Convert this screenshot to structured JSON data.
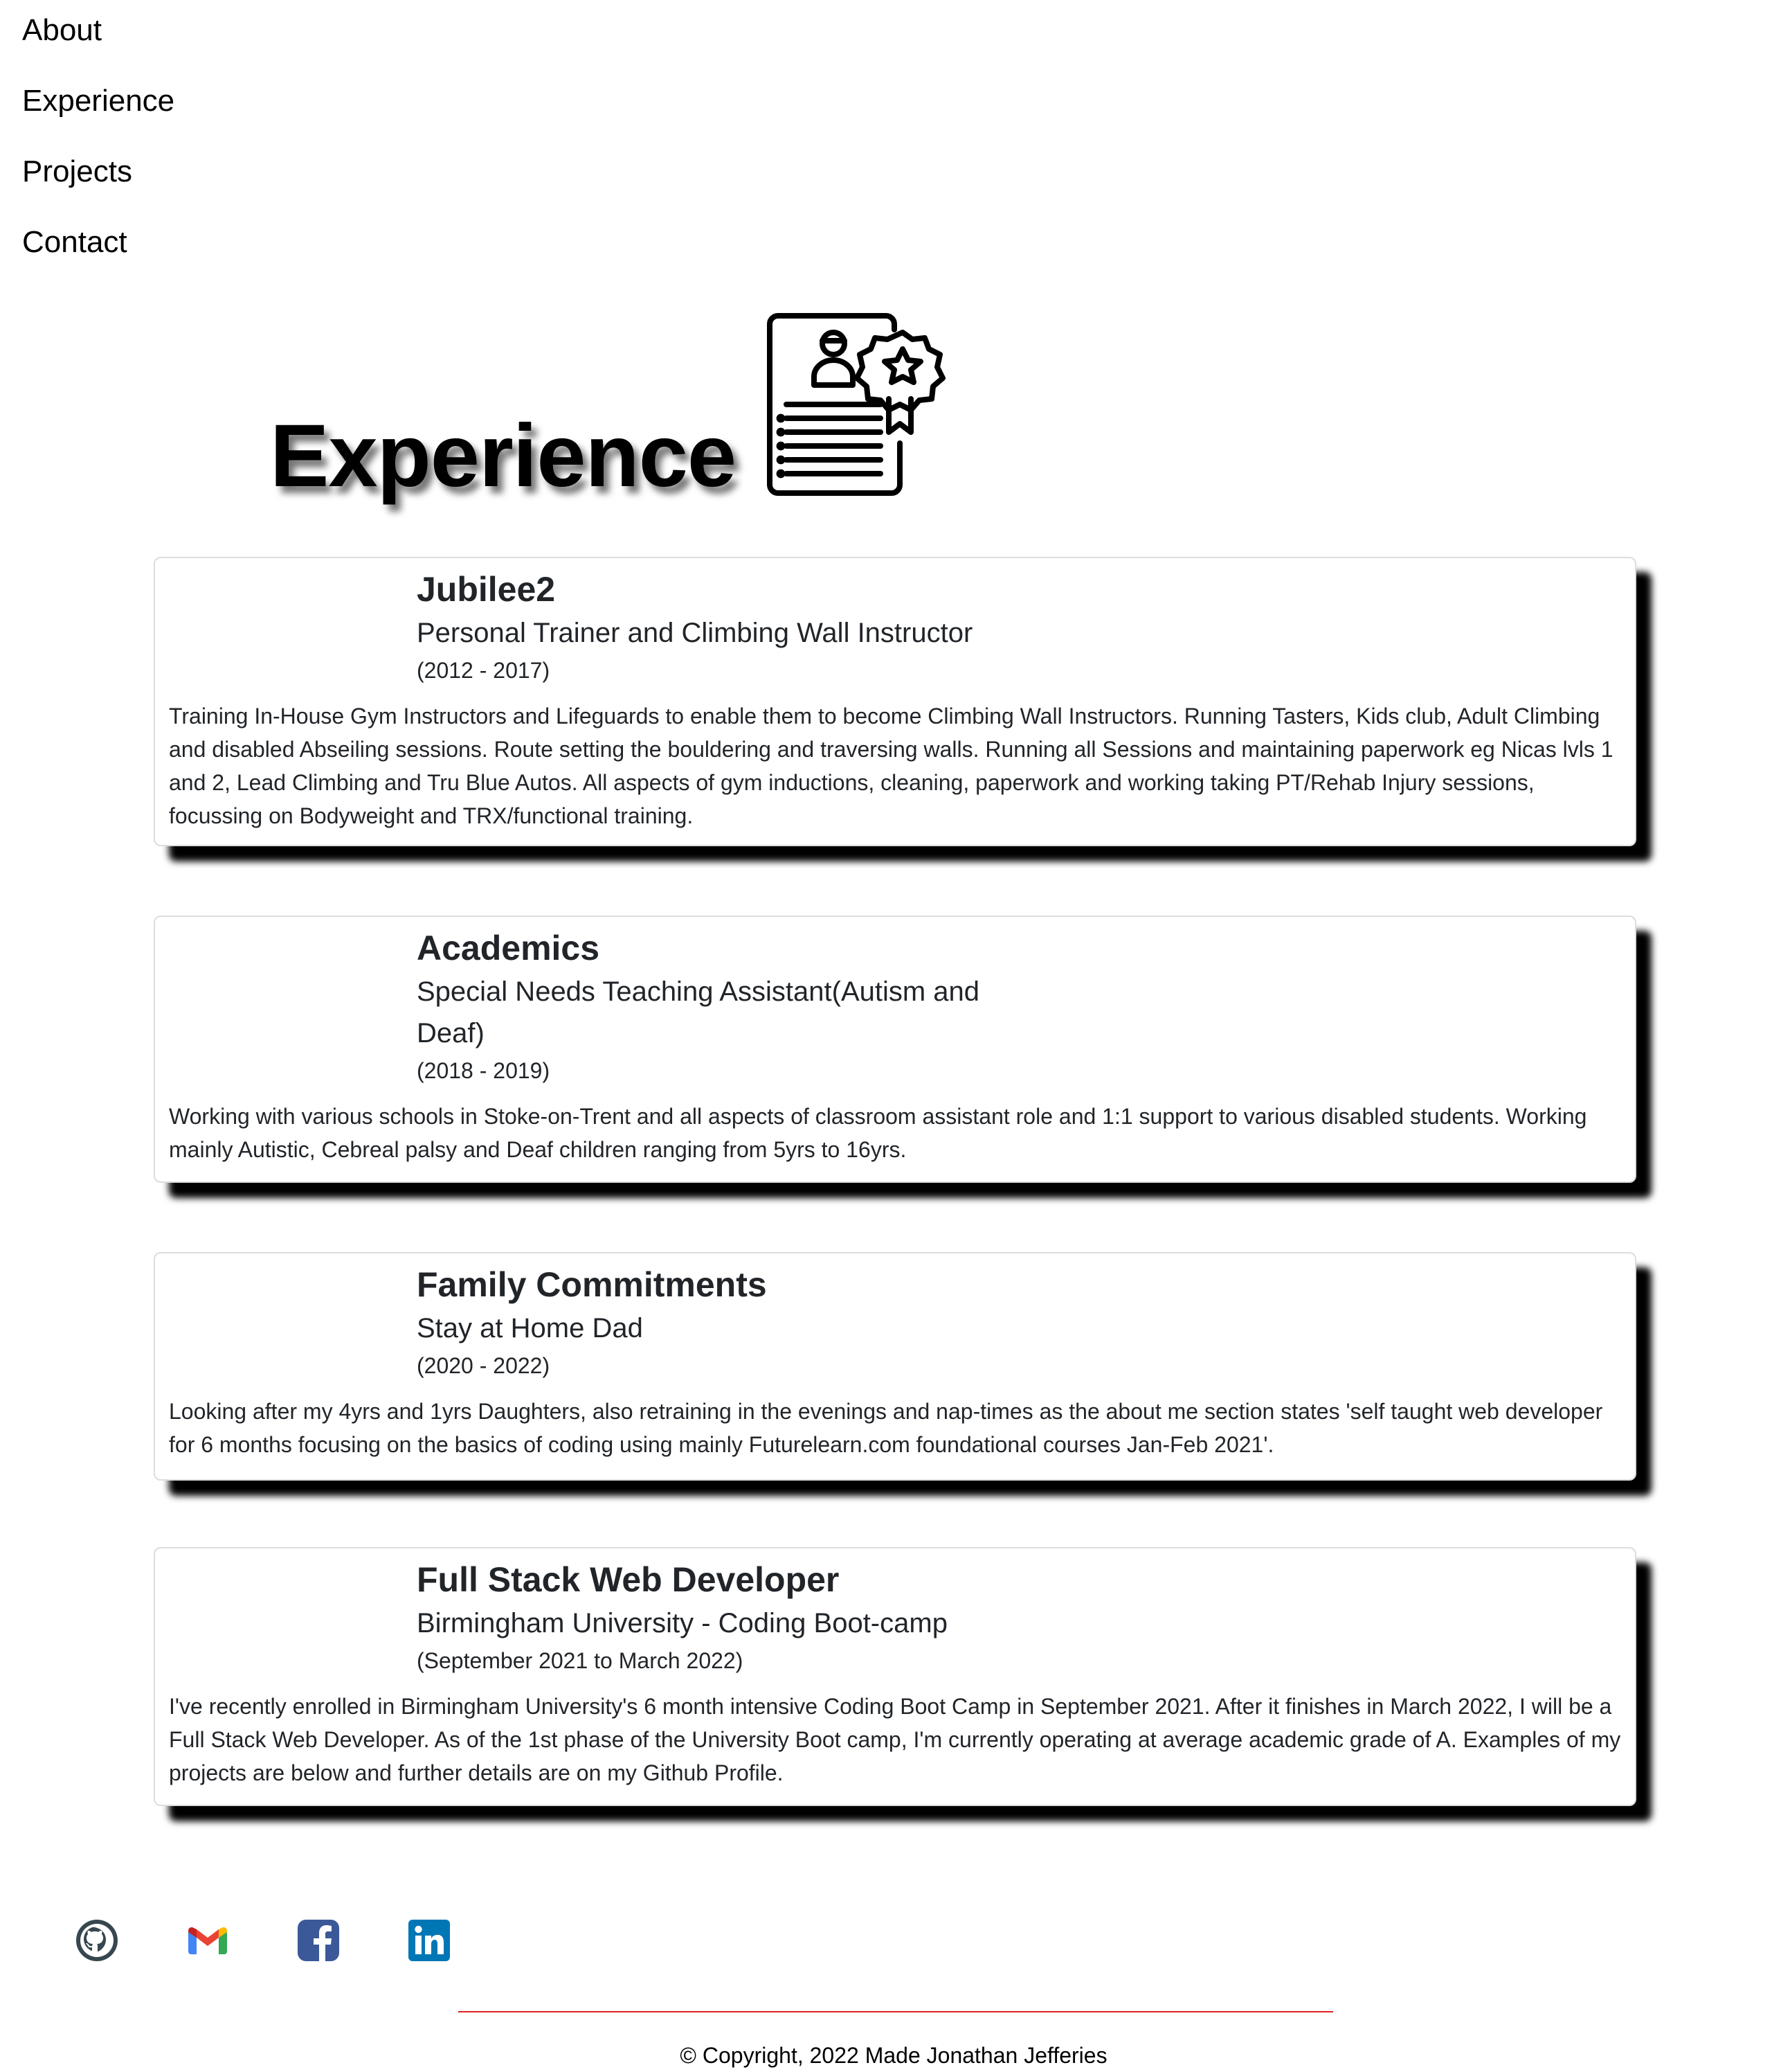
{
  "nav": {
    "items": [
      "About",
      "Experience",
      "Projects",
      "Contact"
    ]
  },
  "experience_section": {
    "title": "Experience",
    "icon": "certificate-award-icon"
  },
  "jobs": [
    {
      "company": "Jubilee2",
      "role": "Personal Trainer and Climbing Wall Instructor",
      "dates": "(2012 - 2017)",
      "description": "Training In-House Gym Instructors and Lifeguards to enable them to become Climbing Wall Instructors. Running Tasters, Kids club, Adult Climbing and disabled Abseiling sessions. Route setting the bouldering and traversing walls. Running all Sessions and maintaining paperwork eg Nicas lvls 1 and 2, Lead Climbing and Tru Blue Autos. All aspects of gym inductions, cleaning, paperwork and working taking PT/Rehab Injury sessions, focussing on Bodyweight and TRX/functional training."
    },
    {
      "company": "Academics",
      "role": "Special Needs Teaching Assistant(Autism and Deaf)",
      "dates": "(2018 - 2019)",
      "description": "Working with various schools in Stoke-on-Trent and all aspects of classroom assistant role and 1:1 support to various disabled students. Working mainly Autistic, Cebreal palsy and Deaf children ranging from 5yrs to 16yrs."
    },
    {
      "company": "Family Commitments",
      "role": "Stay at Home Dad",
      "dates": "(2020 - 2022)",
      "description": "Looking after my 4yrs and 1yrs Daughters, also retraining in the evenings and nap-times as the about me section states 'self taught web developer for 6 months focusing on the basics of coding using mainly Futurelearn.com foundational courses Jan-Feb 2021'."
    },
    {
      "company": "Full Stack Web Developer",
      "role": "Birmingham University - Coding Boot-camp",
      "dates": "(September 2021 to March 2022)",
      "description": "I've recently enrolled in Birmingham University's 6 month intensive Coding Boot Camp in September 2021. After it finishes in March 2022, I will be a Full Stack Web Developer. As of the 1st phase of the University Boot camp, I'm currently operating at average academic grade of A. Examples of my projects are below and further details are on my Github Profile."
    }
  ],
  "social": {
    "icons": [
      "github-icon",
      "gmail-icon",
      "facebook-icon",
      "linkedin-icon"
    ],
    "colors": {
      "github": "#24292e",
      "gmail_red": "#ea4335",
      "gmail_blue": "#4285f4",
      "gmail_green": "#34a853",
      "gmail_yellow": "#fbbc04",
      "facebook": "#3b5998",
      "linkedin": "#0077b5"
    }
  },
  "footer": {
    "copyright": "© Copyright, 2022 Made Jonathan Jefferies",
    "rule_color": "#e02020"
  }
}
